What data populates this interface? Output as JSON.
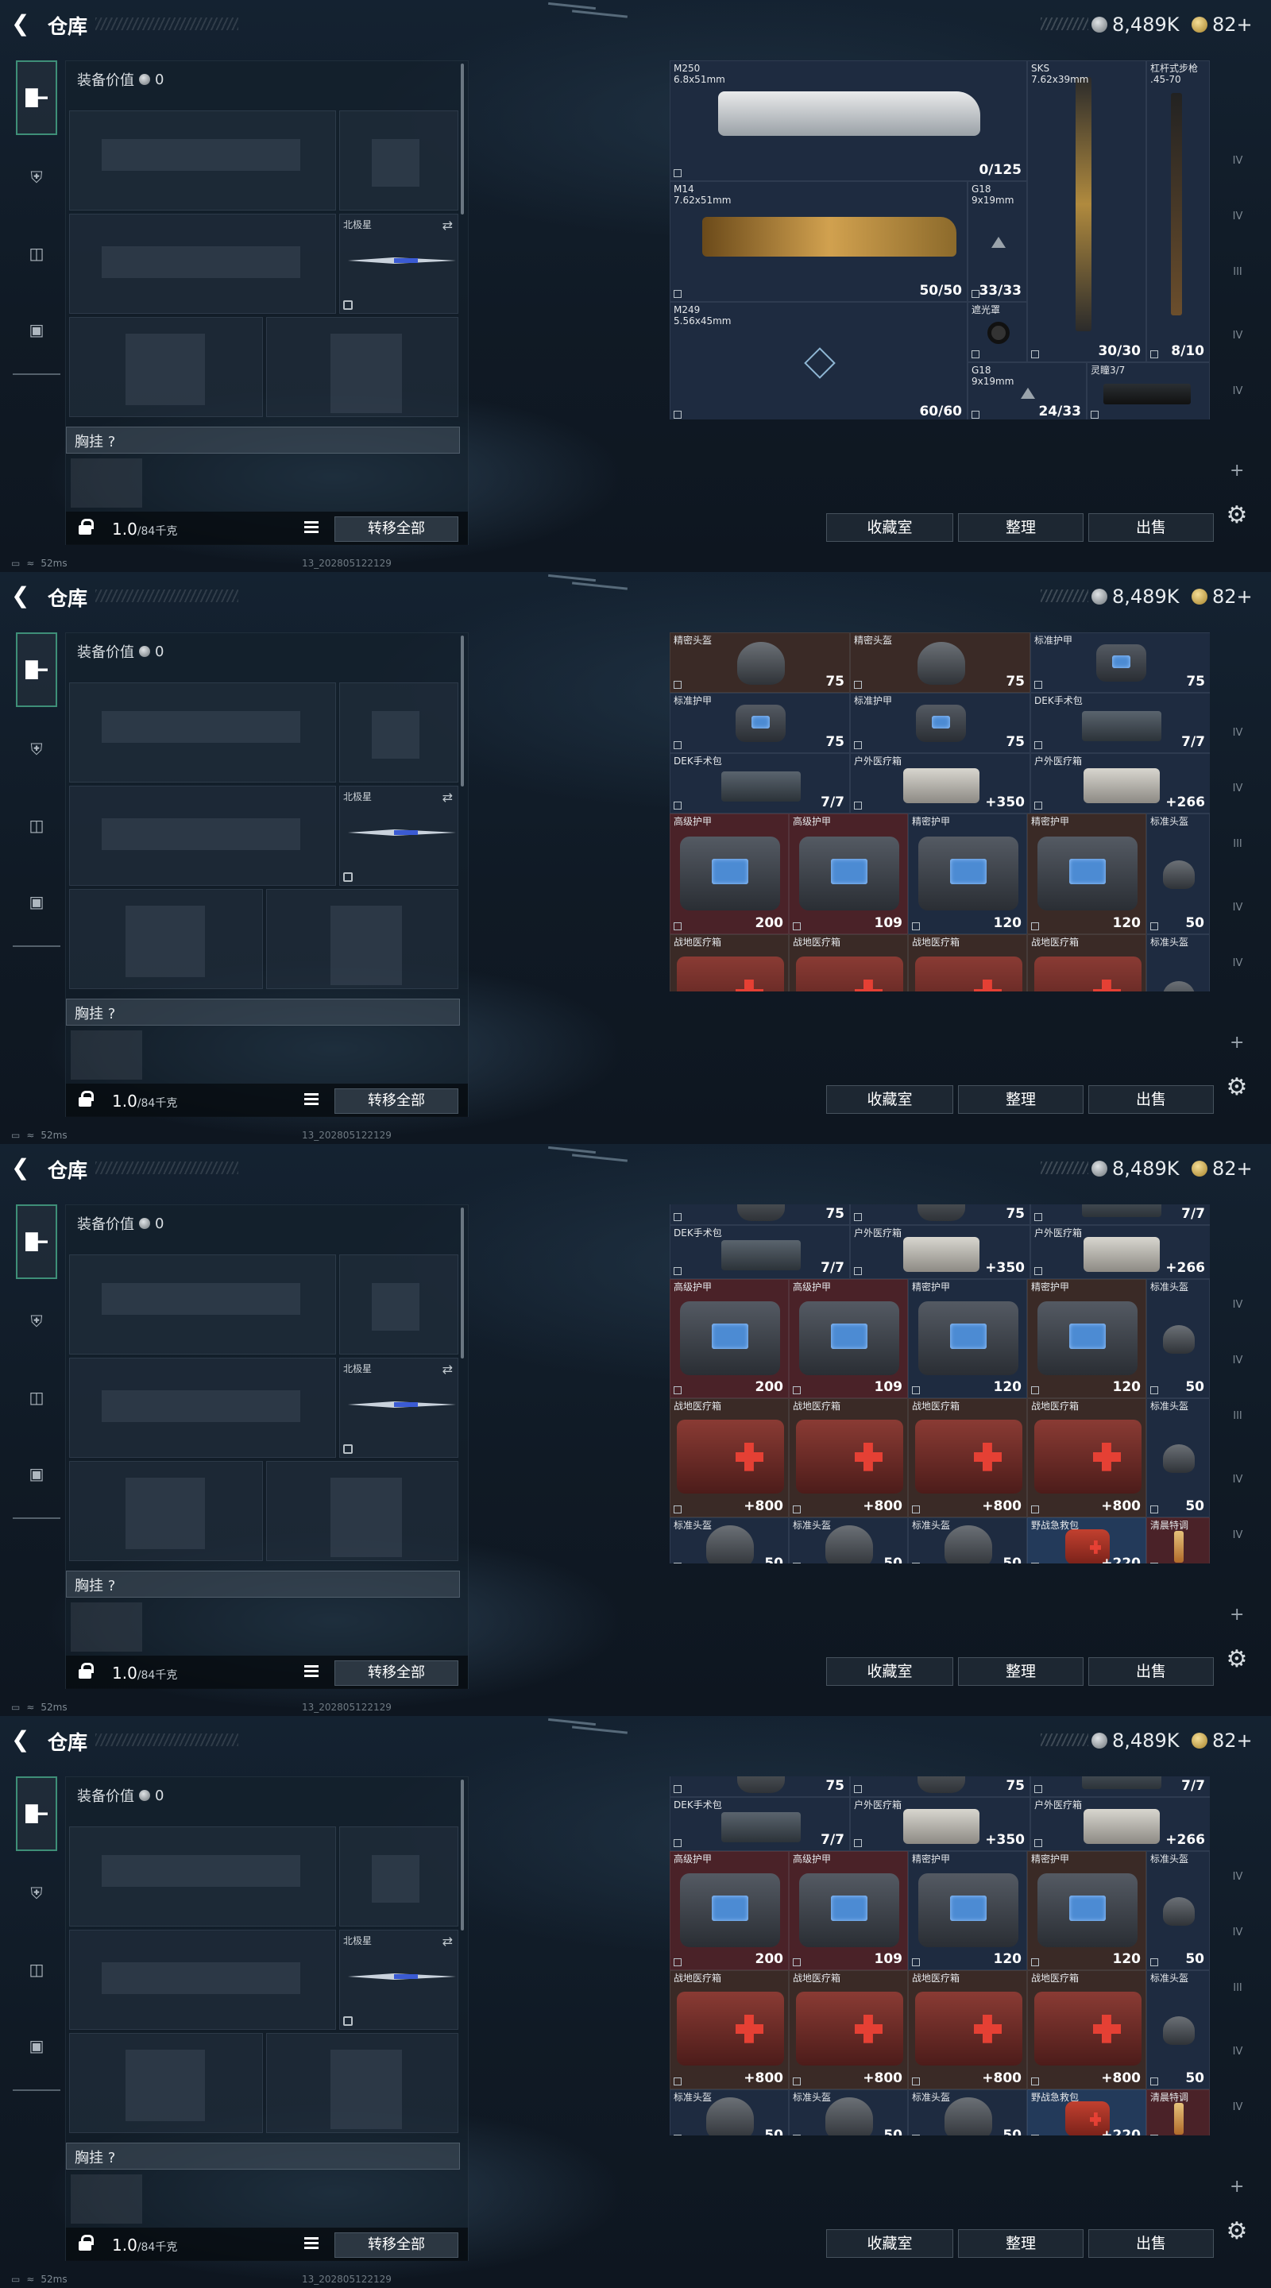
{
  "header": {
    "title": "仓库",
    "currency": "8,489K",
    "tickets": "82+"
  },
  "loadout": {
    "value_label": "装备价值",
    "value": "0",
    "melee_label": "北极星",
    "chest_label": "胸挂  ?",
    "weight": "1.0",
    "weight_cap": "/84千克",
    "transfer_all": "转移全部"
  },
  "actions": {
    "collect": "收藏室",
    "sort": "整理",
    "sell": "出售"
  },
  "status": {
    "ping": "52ms",
    "build": "13_20280512212​9"
  },
  "frame1": [
    {
      "name": "M250\n6.8x51mm",
      "value": "0/125"
    },
    {
      "name": "SKS\n7.62x39mm",
      "value": "30/30"
    },
    {
      "name": "杠杆式步枪\n.45-70",
      "value": "8/10"
    },
    {
      "name": "M14\n7.62x51mm",
      "value": "50/50"
    },
    {
      "name": "G18\n9x19mm",
      "value": "33/33"
    },
    {
      "name": "M249\n5.56x45mm",
      "value": "60/60"
    },
    {
      "name": "遮光罩",
      "value": ""
    },
    {
      "name": "G18\n9x19mm",
      "value": "24/33"
    },
    {
      "name": "灵瞳3/7",
      "value": ""
    }
  ],
  "frame2": [
    {
      "name": "精密头盔",
      "value": "75"
    },
    {
      "name": "精密头盔",
      "value": "75"
    },
    {
      "name": "标准护甲",
      "value": "75"
    },
    {
      "name": "标准护甲",
      "value": "75"
    },
    {
      "name": "标准护甲",
      "value": "75"
    },
    {
      "name": "DEK手术包",
      "value": "7/7"
    },
    {
      "name": "DEK手术包",
      "value": "7/7"
    },
    {
      "name": "户外医疗箱",
      "value": "+350"
    },
    {
      "name": "户外医疗箱",
      "value": "+266"
    },
    {
      "name": "高级护甲",
      "value": "200"
    },
    {
      "name": "高级护甲",
      "value": "109"
    },
    {
      "name": "精密护甲",
      "value": "120"
    },
    {
      "name": "精密护甲",
      "value": "120"
    },
    {
      "name": "标准头盔",
      "value": "50"
    },
    {
      "name": "战地医疗箱",
      "value": "+800"
    },
    {
      "name": "战地医疗箱",
      "value": "+800"
    },
    {
      "name": "战地医疗箱",
      "value": "+800"
    },
    {
      "name": "战地医疗箱",
      "value": "+800"
    },
    {
      "name": "标准头盔",
      "value": "50"
    },
    {
      "name": "标准头盔",
      "value": ""
    },
    {
      "name": "标准头盔",
      "value": ""
    },
    {
      "name": "标准头盔",
      "value": ""
    },
    {
      "name": "野战急救包",
      "value": ""
    },
    {
      "name": "清晨特调",
      "value": ""
    }
  ],
  "frame3": [
    {
      "name": "",
      "value": "75"
    },
    {
      "name": "",
      "value": "75"
    },
    {
      "name": "",
      "value": "7/7"
    },
    {
      "name": "DEK手术包",
      "value": "7/7"
    },
    {
      "name": "户外医疗箱",
      "value": "+350"
    },
    {
      "name": "户外医疗箱",
      "value": "+266"
    },
    {
      "name": "高级护甲",
      "value": "200"
    },
    {
      "name": "高级护甲",
      "value": "109"
    },
    {
      "name": "精密护甲",
      "value": "120"
    },
    {
      "name": "精密护甲",
      "value": "120"
    },
    {
      "name": "标准头盔",
      "value": "50"
    },
    {
      "name": "战地医疗箱",
      "value": "+800"
    },
    {
      "name": "战地医疗箱",
      "value": "+800"
    },
    {
      "name": "战地医疗箱",
      "value": "+800"
    },
    {
      "name": "战地医疗箱",
      "value": "+800"
    },
    {
      "name": "标准头盔",
      "value": "50"
    },
    {
      "name": "标准头盔",
      "value": "50"
    },
    {
      "name": "标准头盔",
      "value": "50"
    },
    {
      "name": "标准头盔",
      "value": "50"
    },
    {
      "name": "野战急救包",
      "value": "+220"
    },
    {
      "name": "清晨特调",
      "value": ""
    }
  ],
  "frame4": [
    {
      "name": "",
      "value": "75"
    },
    {
      "name": "",
      "value": "75"
    },
    {
      "name": "",
      "value": "7/7"
    },
    {
      "name": "DEK手术包",
      "value": "7/7"
    },
    {
      "name": "户外医疗箱",
      "value": "+350"
    },
    {
      "name": "户外医疗箱",
      "value": "+266"
    },
    {
      "name": "高级护甲",
      "value": "200"
    },
    {
      "name": "高级护甲",
      "value": "109"
    },
    {
      "name": "精密护甲",
      "value": "120"
    },
    {
      "name": "精密护甲",
      "value": "120"
    },
    {
      "name": "标准头盔",
      "value": "50"
    },
    {
      "name": "战地医疗箱",
      "value": "+800"
    },
    {
      "name": "战地医疗箱",
      "value": "+800"
    },
    {
      "name": "战地医疗箱",
      "value": "+800"
    },
    {
      "name": "战地医疗箱",
      "value": "+800"
    },
    {
      "name": "标准头盔",
      "value": "50"
    },
    {
      "name": "标准头盔",
      "value": "50"
    },
    {
      "name": "标准头盔",
      "value": "50"
    },
    {
      "name": "标准头盔",
      "value": "50"
    },
    {
      "name": "野战急救包",
      "value": "+220"
    },
    {
      "name": "清晨特调",
      "value": ""
    }
  ],
  "right_rail": [
    "",
    "IV",
    "IV",
    "III",
    "IV",
    "IV",
    "+"
  ],
  "colors": {
    "accent": "#3e8f78",
    "armor_blue": "#4c8bd3",
    "medkit_red": "#e54034"
  }
}
